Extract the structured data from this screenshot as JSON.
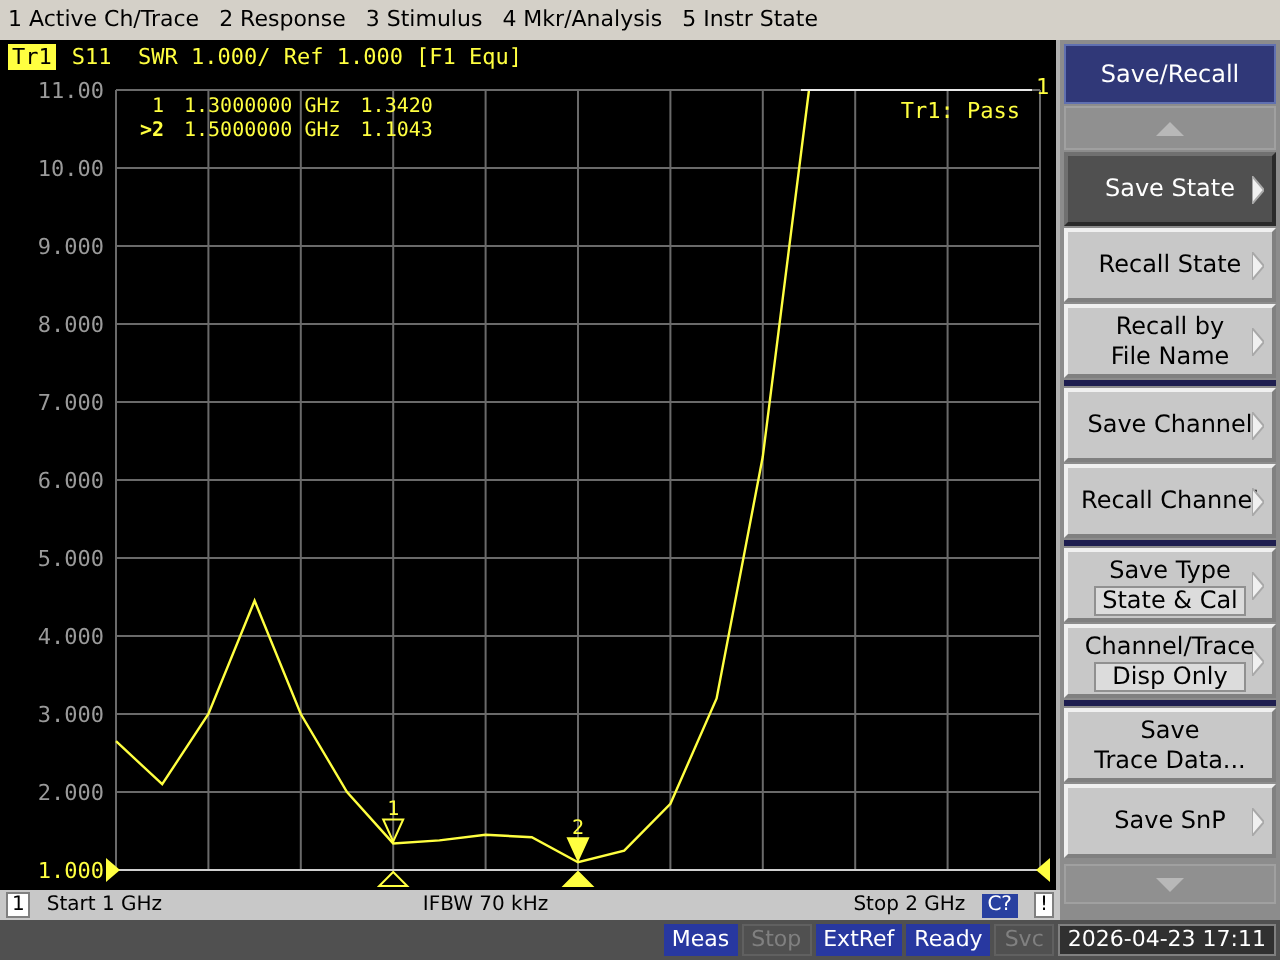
{
  "menu_bar": [
    "1 Active Ch/Trace",
    "2 Response",
    "3 Stimulus",
    "4 Mkr/Analysis",
    "5 Instr State"
  ],
  "trace_header": {
    "trace": "Tr1",
    "text": "S11  SWR 1.000/ Ref 1.000 [F1 Equ]"
  },
  "marker_table": [
    {
      "label": "1",
      "active": false,
      "frequency": "1.3000000 GHz",
      "value": "1.3420"
    },
    {
      "label": ">2",
      "active": true,
      "frequency": "1.5000000 GHz",
      "value": "1.1043"
    }
  ],
  "limit_status": "Tr1: Pass",
  "limit_end_label": "1",
  "chart_data": {
    "type": "line",
    "categories": [
      null,
      null,
      null,
      null,
      null,
      null,
      null,
      null,
      null,
      null,
      null,
      null,
      null,
      null,
      null,
      null,
      null,
      null,
      null,
      null,
      null
    ],
    "series": [
      {
        "color": "#ffff40",
        "values": [
          2.65,
          2.1,
          3.0,
          4.45,
          3.0,
          2.0,
          1.34,
          1.38,
          1.45,
          1.42,
          1.1,
          1.25,
          1.85,
          3.2,
          6.3,
          11,
          null,
          null,
          null,
          null,
          null
        ]
      }
    ],
    "ylim": [
      1,
      11
    ],
    "grid": true,
    "yticks": [
      {
        "value": 11,
        "label": "11.00"
      },
      {
        "value": 10,
        "label": "10.00"
      },
      {
        "value": 9,
        "label": "9.000"
      },
      {
        "value": 8,
        "label": "8.000"
      },
      {
        "value": 7,
        "label": "7.000"
      },
      {
        "value": 6,
        "label": "6.000"
      },
      {
        "value": 5,
        "label": "5.000"
      },
      {
        "value": 4,
        "label": "4.000"
      },
      {
        "value": 3,
        "label": "3.000"
      },
      {
        "value": 2,
        "label": "2.000"
      },
      {
        "value": 1,
        "label": "1.000"
      }
    ]
  },
  "markers": [
    {
      "label": "1",
      "active": false
    },
    {
      "label": "2",
      "active": true
    }
  ],
  "softkey_panel": {
    "title": "Save/Recall",
    "keys": [
      {
        "kind": "submenu",
        "label": "Save State",
        "selected": true,
        "group_start": false
      },
      {
        "kind": "submenu",
        "label": "Recall State",
        "selected": false,
        "group_start": false
      },
      {
        "kind": "submenu",
        "label": "Recall by\nFile Name",
        "selected": false,
        "group_start": false
      },
      {
        "kind": "submenu",
        "label": "Save Channel",
        "selected": false,
        "group_start": true
      },
      {
        "kind": "submenu",
        "label": "Recall Channel",
        "selected": false,
        "group_start": false
      },
      {
        "kind": "value",
        "label": "Save Type",
        "value": "State & Cal",
        "selected": false,
        "group_start": true
      },
      {
        "kind": "value",
        "label": "Channel/Trace",
        "value": "Disp Only",
        "selected": false,
        "group_start": false
      },
      {
        "kind": "action",
        "label": "Save\nTrace Data...",
        "selected": false,
        "group_start": true
      },
      {
        "kind": "submenu",
        "label": "Save SnP",
        "selected": false,
        "group_start": false
      }
    ]
  },
  "channel_bar": {
    "channel": "1",
    "start": "Start 1 GHz",
    "ifbw": "IFBW 70 kHz",
    "stop": "Stop 2 GHz",
    "cal": "C?",
    "warning": "!"
  },
  "status_bar": {
    "indicators": [
      {
        "label": "Meas",
        "active": true
      },
      {
        "label": "Stop",
        "active": false
      },
      {
        "label": "ExtRef",
        "active": true
      },
      {
        "label": "Ready",
        "active": true
      },
      {
        "label": "Svc",
        "active": false
      }
    ],
    "datetime": "2026-04-23 17:11"
  }
}
